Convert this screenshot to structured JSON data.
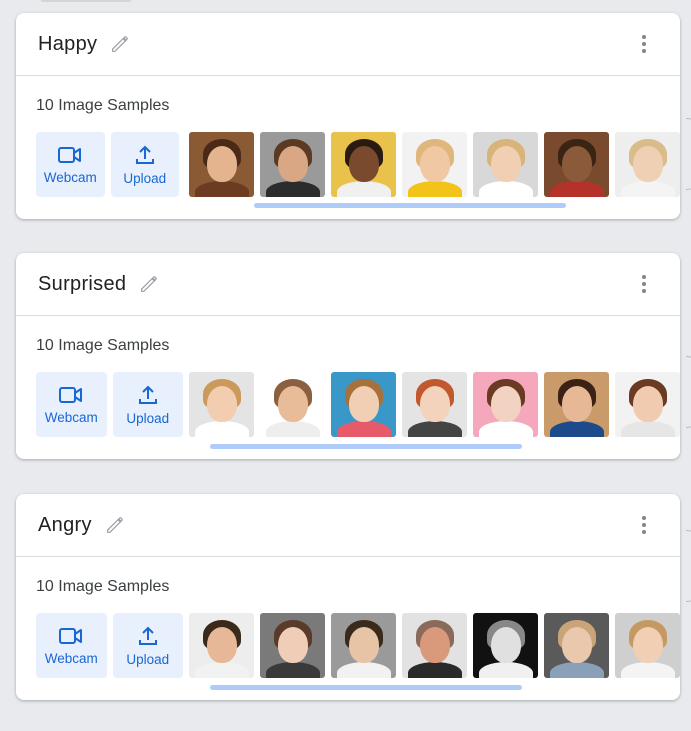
{
  "cards": [
    {
      "name": "Happy",
      "samples": "10 Image Samples",
      "webcam": "Webcam",
      "upload": "Upload",
      "thumbs": [
        {
          "bg": "#8a5a34",
          "skin": "#e4b48f",
          "hair": "#4a2a16",
          "shirt": "#6b3b22"
        },
        {
          "bg": "#9a9a9a",
          "skin": "#d9a784",
          "hair": "#5a3a22",
          "shirt": "#2c2c2c"
        },
        {
          "bg": "#e8c24a",
          "skin": "#7a4a2e",
          "hair": "#2a1a10",
          "shirt": "#f0f0f0"
        },
        {
          "bg": "#f2f2f2",
          "skin": "#f0c8a4",
          "hair": "#e0b77a",
          "shirt": "#f2c318"
        },
        {
          "bg": "#d8d8d8",
          "skin": "#f1cfb3",
          "hair": "#d9b47a",
          "shirt": "#ffffff"
        },
        {
          "bg": "#7a4a2e",
          "skin": "#8a5a3a",
          "hair": "#3a2414",
          "shirt": "#b5322a"
        },
        {
          "bg": "#eeeeee",
          "skin": "#f0d0b4",
          "hair": "#d8bc8a",
          "shirt": "#f4f4f4"
        }
      ]
    },
    {
      "name": "Surprised",
      "samples": "10 Image Samples",
      "webcam": "Webcam",
      "upload": "Upload",
      "thumbs": [
        {
          "bg": "#e4e4e4",
          "skin": "#f2cdb0",
          "hair": "#c99a5a",
          "shirt": "#ffffff"
        },
        {
          "bg": "#ffffff",
          "skin": "#e8bc98",
          "hair": "#8a6040",
          "shirt": "#eeeeee"
        },
        {
          "bg": "#3a98c8",
          "skin": "#f1cfb4",
          "hair": "#a8703a",
          "shirt": "#e65a6a"
        },
        {
          "bg": "#e4e4e4",
          "skin": "#f3d3bc",
          "hair": "#c2582e",
          "shirt": "#444444"
        },
        {
          "bg": "#f5a8bc",
          "skin": "#f2d2c0",
          "hair": "#6a3a24",
          "shirt": "#ffffff"
        },
        {
          "bg": "#c99a6a",
          "skin": "#e6b896",
          "hair": "#3a2214",
          "shirt": "#1d4a8a"
        },
        {
          "bg": "#f2f2f2",
          "skin": "#f1cbb0",
          "hair": "#6a3a22",
          "shirt": "#e6e6e6"
        }
      ]
    },
    {
      "name": "Angry",
      "samples": "10 Image Samples",
      "webcam": "Webcam",
      "upload": "Upload",
      "thumbs": [
        {
          "bg": "#ededed",
          "skin": "#e6b898",
          "hair": "#3a2a1c",
          "shirt": "#f2f2f2"
        },
        {
          "bg": "#7a7a7a",
          "skin": "#f0cdb6",
          "hair": "#5a3a28",
          "shirt": "#3a3a3a"
        },
        {
          "bg": "#9a9a9a",
          "skin": "#e8c4a6",
          "hair": "#3a2a1c",
          "shirt": "#f2f2f2"
        },
        {
          "bg": "#e2e2e2",
          "skin": "#d89a7a",
          "hair": "#8a6a5a",
          "shirt": "#2a2a2a"
        },
        {
          "bg": "#111111",
          "skin": "#e0e0e0",
          "hair": "#888888",
          "shirt": "#f0f0f0"
        },
        {
          "bg": "#5a5a5a",
          "skin": "#eac8ae",
          "hair": "#c8a478",
          "shirt": "#8aa0b8"
        },
        {
          "bg": "#cfcfcf",
          "skin": "#f0cfb4",
          "hair": "#c49a62",
          "shirt": "#f4f4f4"
        }
      ]
    }
  ]
}
